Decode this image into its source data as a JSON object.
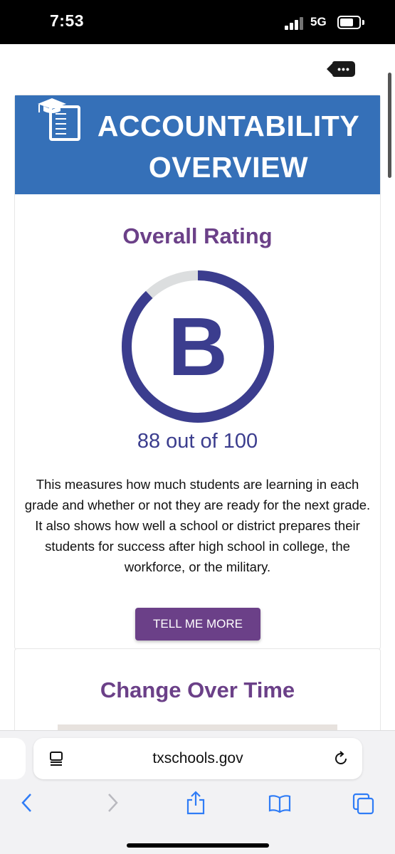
{
  "status_bar": {
    "time": "7:53",
    "network": "5G"
  },
  "banner": {
    "title_line1": "ACCOUNTABILITY",
    "title_line2": "OVERVIEW",
    "icon": "report-card-icon"
  },
  "overall_rating": {
    "heading": "Overall Rating",
    "letter_grade": "B",
    "score": 88,
    "score_max": 100,
    "score_text": "88 out of 100",
    "description": "This measures how much students are learning in each grade and whether or not they are ready for the next grade. It also shows how well a school or district prepares their students for success after high school in college, the workforce, or the military.",
    "button_label": "TELL ME MORE"
  },
  "change_over_time": {
    "heading": "Change Over Time"
  },
  "browser": {
    "url": "txschools.gov",
    "icons": [
      "page-menu-icon",
      "reload-icon",
      "back-icon",
      "forward-icon",
      "share-icon",
      "bookmarks-icon",
      "tabs-icon"
    ]
  },
  "colors": {
    "banner_blue": "#3570b8",
    "heading_purple": "#6b4088",
    "gauge_navy": "#3b3d8e",
    "gauge_track": "#dcdedf",
    "ios_blue": "#2f7cf6"
  }
}
